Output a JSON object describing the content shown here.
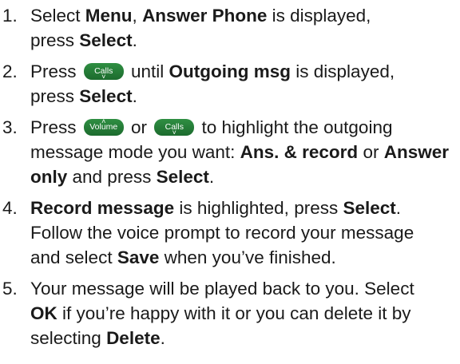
{
  "steps": [
    {
      "number": "1.",
      "parts": [
        {
          "t": "text",
          "v": "Select "
        },
        {
          "t": "bold",
          "v": "Menu"
        },
        {
          "t": "text",
          "v": ", "
        },
        {
          "t": "bold",
          "v": "Answer Phone"
        },
        {
          "t": "text",
          "v": " is displayed,"
        },
        {
          "t": "br"
        },
        {
          "t": "text",
          "v": "press "
        },
        {
          "t": "bold",
          "v": "Select"
        },
        {
          "t": "text",
          "v": "."
        }
      ]
    },
    {
      "number": "2.",
      "parts": [
        {
          "t": "text",
          "v": "Press "
        },
        {
          "t": "key",
          "v": "Calls",
          "arrow": "down"
        },
        {
          "t": "text",
          "v": " until "
        },
        {
          "t": "bold",
          "v": "Outgoing msg"
        },
        {
          "t": "text",
          "v": " is displayed,"
        },
        {
          "t": "br"
        },
        {
          "t": "text",
          "v": "press "
        },
        {
          "t": "bold",
          "v": "Select"
        },
        {
          "t": "text",
          "v": "."
        }
      ]
    },
    {
      "number": "3.",
      "parts": [
        {
          "t": "text",
          "v": "Press "
        },
        {
          "t": "key",
          "v": "Volume",
          "arrow": "up"
        },
        {
          "t": "text",
          "v": " or "
        },
        {
          "t": "key",
          "v": "Calls",
          "arrow": "down"
        },
        {
          "t": "text",
          "v": " to highlight the outgoing"
        },
        {
          "t": "br"
        },
        {
          "t": "text",
          "v": "message mode you want: "
        },
        {
          "t": "bold",
          "v": "Ans. & record"
        },
        {
          "t": "text",
          "v": " or "
        },
        {
          "t": "bold",
          "v": "Answer"
        },
        {
          "t": "br"
        },
        {
          "t": "bold",
          "v": "only"
        },
        {
          "t": "text",
          "v": " and press "
        },
        {
          "t": "bold",
          "v": "Select"
        },
        {
          "t": "text",
          "v": "."
        }
      ]
    },
    {
      "number": "4.",
      "parts": [
        {
          "t": "bold",
          "v": "Record message"
        },
        {
          "t": "text",
          "v": " is highlighted, press "
        },
        {
          "t": "bold",
          "v": "Select"
        },
        {
          "t": "text",
          "v": "."
        },
        {
          "t": "br"
        },
        {
          "t": "text",
          "v": "Follow the voice prompt to record your message"
        },
        {
          "t": "br"
        },
        {
          "t": "text",
          "v": "and select "
        },
        {
          "t": "bold",
          "v": "Save"
        },
        {
          "t": "text",
          "v": " when you’ve finished."
        }
      ]
    },
    {
      "number": "5.",
      "parts": [
        {
          "t": "text",
          "v": "Your message will be played back to you. Select"
        },
        {
          "t": "br"
        },
        {
          "t": "bold",
          "v": "OK"
        },
        {
          "t": "text",
          "v": " if you’re happy with it or you can delete it by"
        },
        {
          "t": "br"
        },
        {
          "t": "text",
          "v": "selecting "
        },
        {
          "t": "bold",
          "v": "Delete"
        },
        {
          "t": "text",
          "v": "."
        }
      ]
    }
  ]
}
